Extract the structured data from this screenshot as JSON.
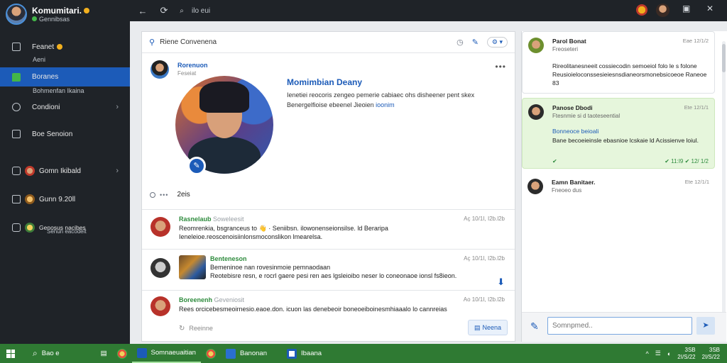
{
  "app": {
    "title": "Komumitari.",
    "subtitle": "Gennibsas"
  },
  "sidebar": {
    "items": [
      {
        "label": "Feanet",
        "sub": "Aeni"
      },
      {
        "label": "Boranes",
        "sub": "Bohmenfan Ikaina"
      },
      {
        "label": "Condioni"
      },
      {
        "label": "Boe Senoion"
      },
      {
        "label": "Gomn Ikibald"
      },
      {
        "label": "Gunn 9.20ll"
      },
      {
        "label": "Genosus nacibes",
        "sub": "Senun eacodeit"
      }
    ]
  },
  "topbar": {
    "search_text": "ilo eui"
  },
  "main": {
    "header_title": "Riene Convenena",
    "profile": {
      "name": "Rorenuon",
      "handle": "Feseiat",
      "bio_title": "Momimbian Deany",
      "bio_line1": "Ienetiei reocoris zengeo pemerie cabiaec ohs disheener pent skex",
      "bio_line2": "Benergelfioise ebeenel Jieoien",
      "bio_link": "ioonim",
      "stat": "2eis"
    },
    "posts": [
      {
        "name": "Rasnelaub",
        "handle": "Soweleesit",
        "time": "Aç 10/1I, I2b.l2b",
        "text": "Reomrenkia, bsgranceus to 👋 · Seniibsn. ilowonenseionsilse. ld Beraripa",
        "text2": "Ieneleioe.reoscenoisiinlonsmoconslikon lmearelsa."
      },
      {
        "name": "Benteneson",
        "handle": "",
        "time": "Aç 10/1I, I2b.l2b",
        "text": "Bemeninoe nan rovesinmoie pemnaodaan",
        "text2": "Reotebisre resn, e rocrl gaere pesi ren aes lgsleioibo neser lo coneonaoe ionsl fs8ieon."
      },
      {
        "name": "Boreenenh",
        "handle": "Geveniosit",
        "time": "Ao 10/1I, I2b.l2b",
        "text": "Rees orcicebesmeoirnesio.eaoe.don. icuon las denebeoir boneoeiboinesmhiaaalo lo cannreias",
        "text2": ""
      }
    ],
    "reply_label": "Reeinne",
    "reply_button": "Neena"
  },
  "chat": {
    "messages": [
      {
        "name": "Parol Bonat",
        "sub": "Freoseteri",
        "time": "Eae 12/1/2",
        "text": "Rireolitanesneeit cossiecodin semoeiol folo le s folone Reusioieloconssesieiesnsdianeorsmonebsicoeoe Raneoe 83",
        "foot": ""
      },
      {
        "name": "Panose Dbodi",
        "sub": "Ftesnmie si d taoteseential",
        "time": "Ete 12/1/1",
        "link": "Bonneoce beioali",
        "text": "Bane becoeieinsle ebasnioe lcskaie ld Acissienve loiul.",
        "foot": "✔ 11:I9 ✔ 12/ 1/2"
      },
      {
        "name": "Eamn Banitaer.",
        "sub": "Fneoeo dus",
        "time": "Ete 12/1/1",
        "text": "",
        "foot": ""
      }
    ],
    "compose_placeholder": "Somnpmed.."
  },
  "taskbar": {
    "search": "Bao e",
    "apps": [
      "Somnaeuaitian",
      "Banonan",
      "Ibaana"
    ],
    "clock_time": "3SB",
    "clock_date": "2I/S/22"
  },
  "colors": {
    "accent": "#1c5bb8",
    "sidebar_bg": "#1f2328",
    "taskbar_bg": "#2f7a33",
    "chat_green": "#e6f6dc"
  }
}
